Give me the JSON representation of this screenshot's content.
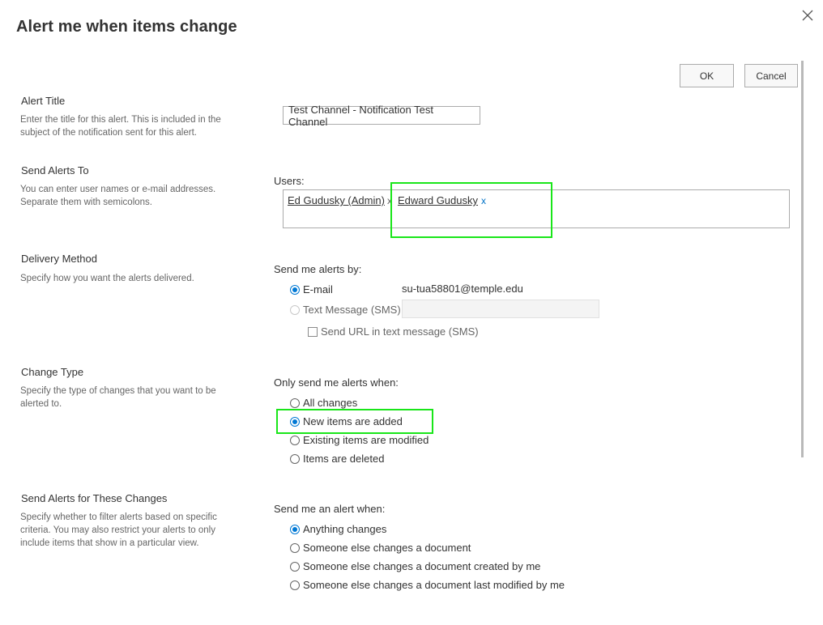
{
  "dialog": {
    "title": "Alert me when items change",
    "ok_label": "OK",
    "cancel_label": "Cancel"
  },
  "alert_title": {
    "heading": "Alert Title",
    "description": "Enter the title for this alert. This is included in the subject of the notification sent for this alert.",
    "value": "Test Channel - Notification Test Channel"
  },
  "send_to": {
    "heading": "Send Alerts To",
    "description": "You can enter user names or e-mail addresses. Separate them with semicolons.",
    "users_label": "Users:",
    "users": [
      {
        "name": "Ed Gudusky (Admin)",
        "remove": "x"
      },
      {
        "name": "Edward Gudusky",
        "remove": "x"
      }
    ]
  },
  "delivery": {
    "heading": "Delivery Method",
    "description": "Specify how you want the alerts delivered.",
    "prompt": "Send me alerts by:",
    "email_label": "E-mail",
    "email_value": "su-tua58801@temple.edu",
    "sms_label": "Text Message (SMS)",
    "sms_value": "",
    "url_label": "Send URL in text message (SMS)",
    "selected": "email"
  },
  "change_type": {
    "heading": "Change Type",
    "description": "Specify the type of changes that you want to be alerted to.",
    "prompt": "Only send me alerts when:",
    "options": [
      "All changes",
      "New items are added",
      "Existing items are modified",
      "Items are deleted"
    ],
    "selected_index": 1
  },
  "filter": {
    "heading": "Send Alerts for These Changes",
    "description": "Specify whether to filter alerts based on specific criteria. You may also restrict your alerts to only include items that show in a particular view.",
    "prompt": "Send me an alert when:",
    "options": [
      "Anything changes",
      "Someone else changes a document",
      "Someone else changes a document created by me",
      "Someone else changes a document last modified by me"
    ],
    "selected_index": 0
  },
  "icons": {
    "close": "close-icon"
  },
  "colors": {
    "accent": "#0078d4",
    "highlight": "#19e619"
  }
}
